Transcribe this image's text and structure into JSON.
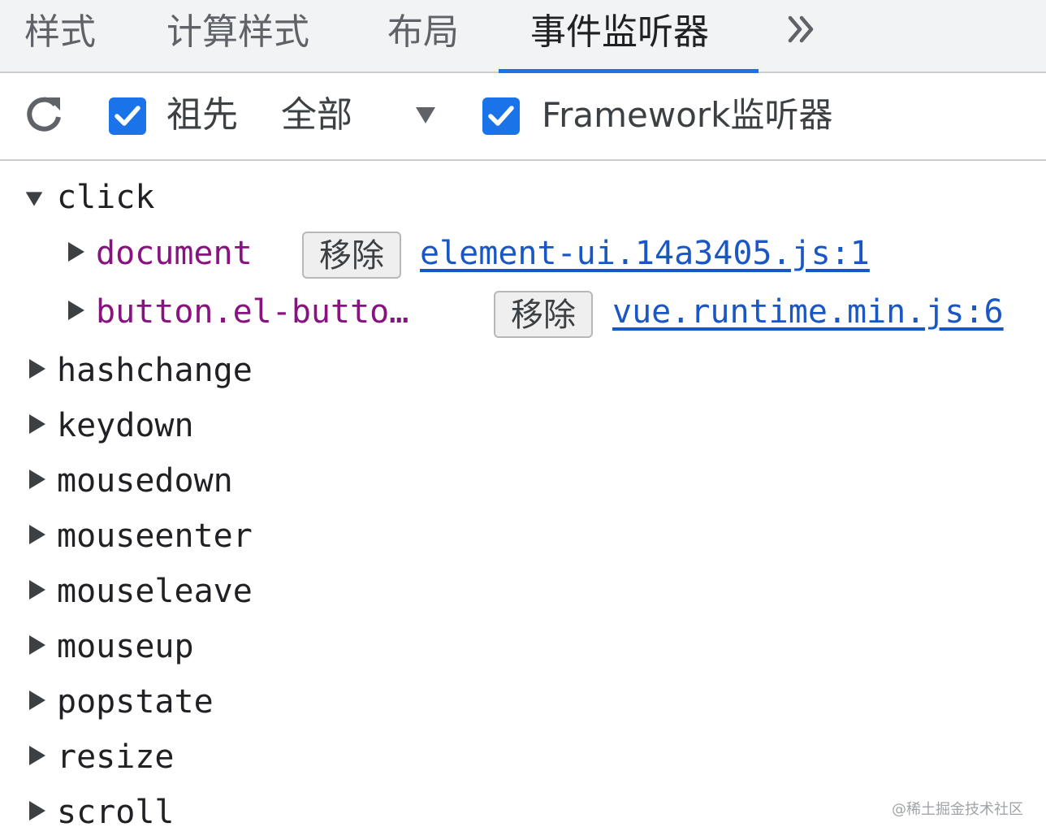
{
  "tabs": [
    {
      "label": "样式",
      "active": false
    },
    {
      "label": "计算样式",
      "active": false
    },
    {
      "label": "布局",
      "active": false
    },
    {
      "label": "事件监听器",
      "active": true
    }
  ],
  "toolbar": {
    "ancestors_label": "祖先",
    "ancestors_checked": true,
    "filter_value": "全部",
    "framework_label": "Framework监听器",
    "framework_checked": true
  },
  "events": [
    {
      "name": "click",
      "expanded": true,
      "listeners": [
        {
          "node": "document",
          "remove_label": "移除",
          "source": "element-ui.14a3405.js:1"
        },
        {
          "node": "button.el-butto…",
          "remove_label": "移除",
          "source": "vue.runtime.min.js:6"
        }
      ]
    },
    {
      "name": "hashchange",
      "expanded": false
    },
    {
      "name": "keydown",
      "expanded": false
    },
    {
      "name": "mousedown",
      "expanded": false
    },
    {
      "name": "mouseenter",
      "expanded": false
    },
    {
      "name": "mouseleave",
      "expanded": false
    },
    {
      "name": "mouseup",
      "expanded": false
    },
    {
      "name": "popstate",
      "expanded": false
    },
    {
      "name": "resize",
      "expanded": false
    },
    {
      "name": "scroll",
      "expanded": false
    }
  ],
  "watermark": "@稀土掘金技术社区",
  "colors": {
    "accent": "#1a73e8",
    "node_name": "#881280",
    "link": "#1a57c4",
    "tabbar_bg": "#f1f3f4"
  },
  "icons": {
    "more_tabs": "chevron-double-right-icon",
    "refresh": "refresh-icon",
    "dropdown": "caret-down-icon",
    "expand": "triangle-right-icon",
    "collapse": "triangle-down-icon"
  }
}
